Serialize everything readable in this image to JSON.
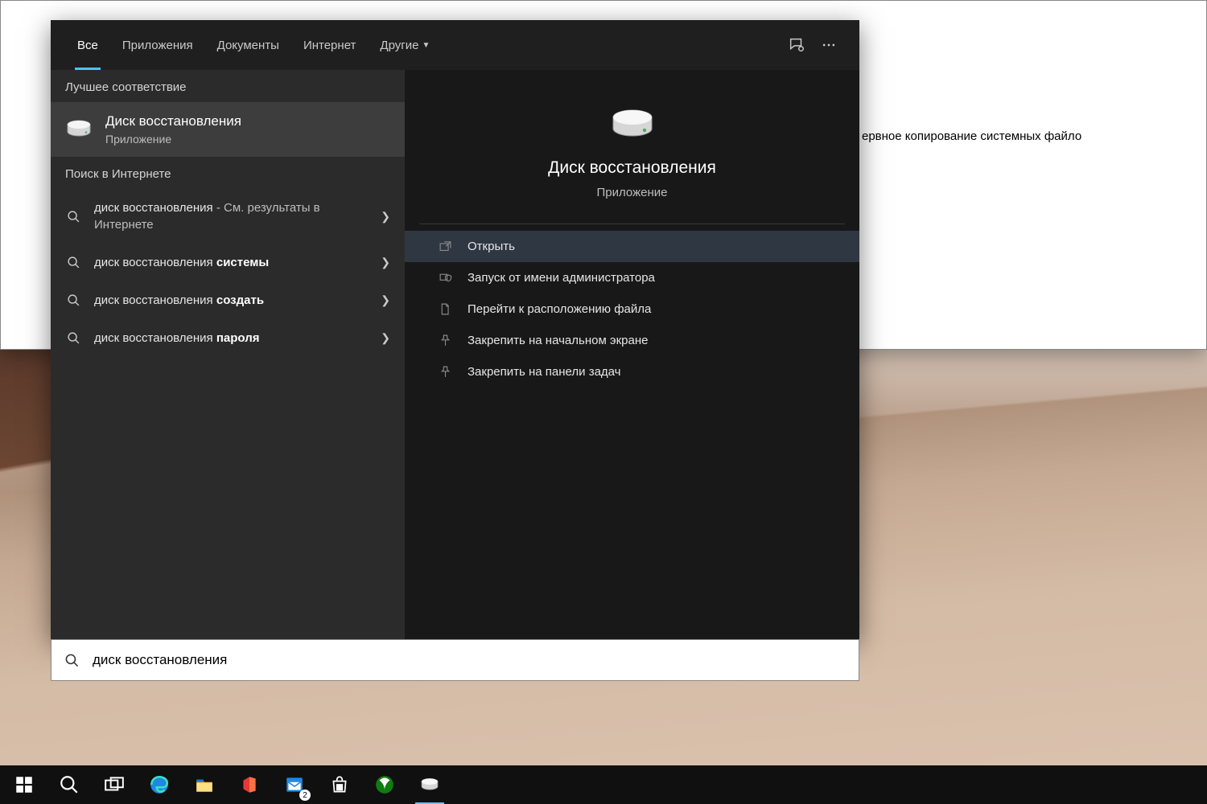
{
  "wizard": {
    "visible_text": "ервное копирование системных файло"
  },
  "search": {
    "tabs": {
      "all": "Все",
      "apps": "Приложения",
      "docs": "Документы",
      "web": "Интернет",
      "more": "Другие"
    },
    "left": {
      "best_match_header": "Лучшее соответствие",
      "best": {
        "title": "Диск восстановления",
        "subtitle": "Приложение"
      },
      "web_header": "Поиск в Интернете",
      "items": [
        {
          "prefix": "диск восстановления",
          "bold": "",
          "suffix": " - См. результаты в Интернете"
        },
        {
          "prefix": "диск восстановления ",
          "bold": "системы",
          "suffix": ""
        },
        {
          "prefix": "диск восстановления ",
          "bold": "создать",
          "suffix": ""
        },
        {
          "prefix": "диск восстановления ",
          "bold": "пароля",
          "suffix": ""
        }
      ]
    },
    "right": {
      "title": "Диск восстановления",
      "subtitle": "Приложение",
      "actions": {
        "open": "Открыть",
        "admin": "Запуск от имени администратора",
        "location": "Перейти к расположению файла",
        "pin_start": "Закрепить на начальном экране",
        "pin_taskbar": "Закрепить на панели задач"
      }
    },
    "input_value": "диск восстановления"
  },
  "taskbar": {
    "badge": "2"
  }
}
